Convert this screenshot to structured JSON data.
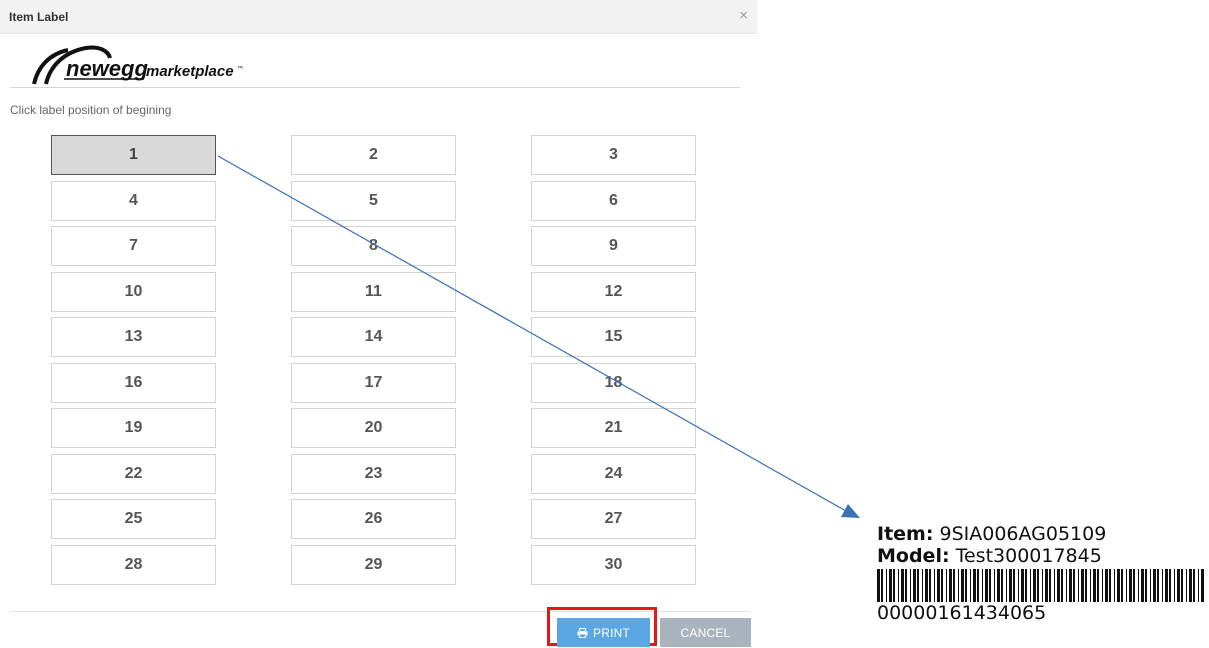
{
  "dialog": {
    "title": "Item Label",
    "close_glyph": "×",
    "logo_text": "neweggmarketplace",
    "instruction": "Click label position of begining"
  },
  "positions": [
    "1",
    "2",
    "3",
    "4",
    "5",
    "6",
    "7",
    "8",
    "9",
    "10",
    "11",
    "12",
    "13",
    "14",
    "15",
    "16",
    "17",
    "18",
    "19",
    "20",
    "21",
    "22",
    "23",
    "24",
    "25",
    "26",
    "27",
    "28",
    "29",
    "30"
  ],
  "selected_position": "1",
  "buttons": {
    "print_label": "PRINT",
    "print_icon": "printer-icon",
    "cancel_label": "CANCEL"
  },
  "label_preview": {
    "item_key": "Item:",
    "item_value": " 9SIA006AG05109",
    "model_key": "Model:",
    "model_value": " Test300017845",
    "barcode_number": "00000161434065"
  },
  "colors": {
    "print_button": "#5aa7e3",
    "cancel_button": "#a9b3bd",
    "highlight": "#e8141a",
    "arrow": "#3b6fb6",
    "selected_cell": "#d9d9d9"
  }
}
